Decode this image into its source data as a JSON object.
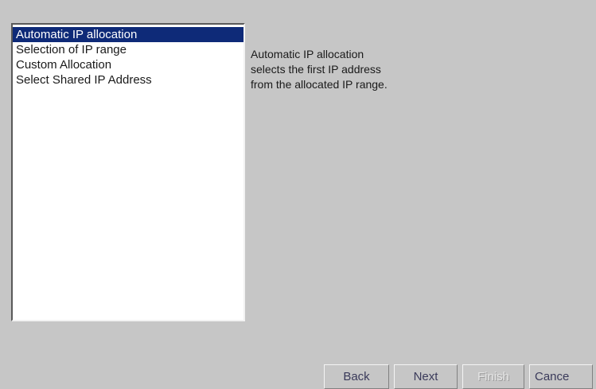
{
  "allocation_list": {
    "items": [
      {
        "label": "Automatic IP allocation",
        "selected": true
      },
      {
        "label": "Selection of IP range",
        "selected": false
      },
      {
        "label": "Custom Allocation",
        "selected": false
      },
      {
        "label": "Select Shared IP Address",
        "selected": false
      }
    ]
  },
  "description": {
    "lines": [
      "Automatic IP allocation",
      "selects the first IP address",
      "from the allocated IP range."
    ]
  },
  "buttons": {
    "back": "Back",
    "next": "Next",
    "finish": "Finish",
    "cancel": "Cance"
  },
  "colors": {
    "background": "#c6c6c6",
    "selection": "#0e2a78"
  }
}
